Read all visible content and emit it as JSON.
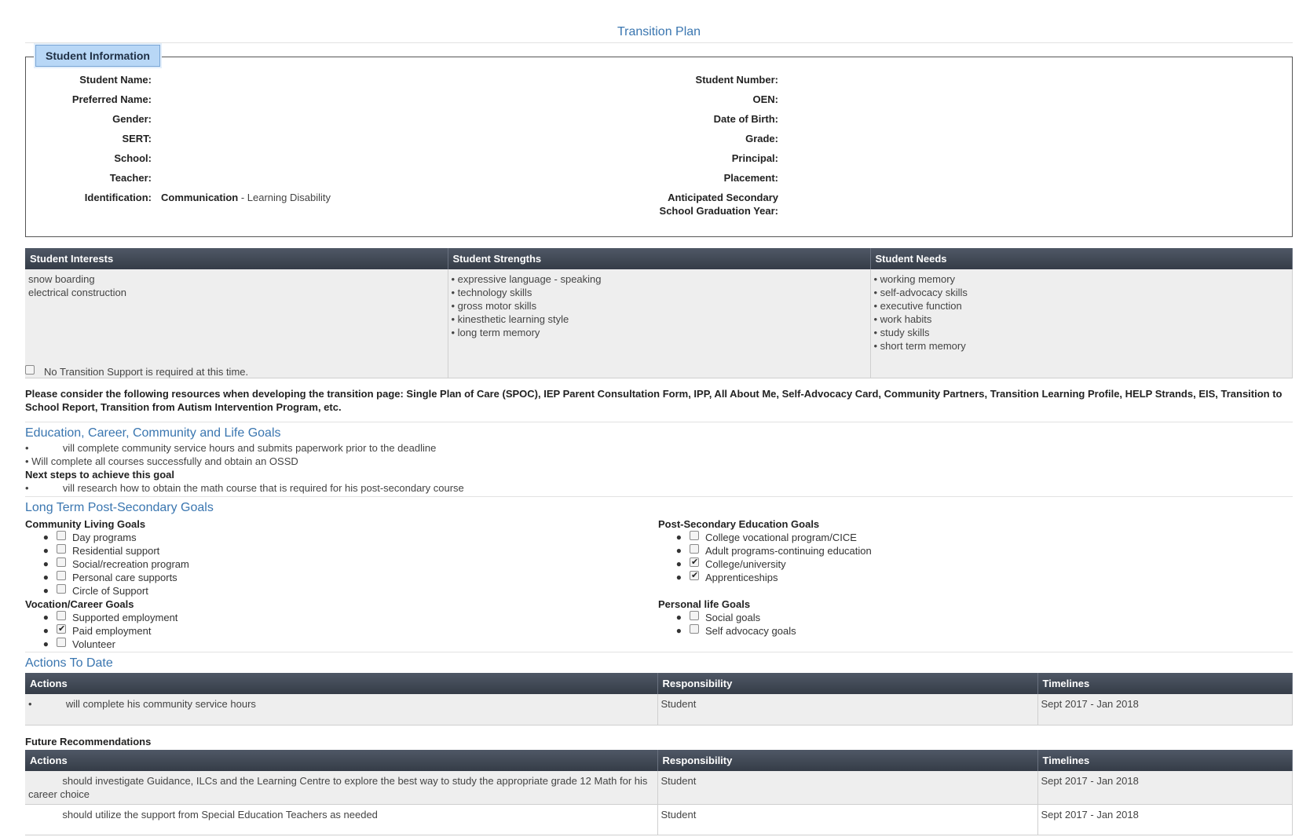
{
  "title": "Transition Plan",
  "student_info": {
    "legend": "Student Information",
    "left": [
      {
        "label": "Student Name:",
        "value": ""
      },
      {
        "label": "Preferred Name:",
        "value": ""
      },
      {
        "label": "Gender:",
        "value": ""
      },
      {
        "label": "SERT:",
        "value": ""
      },
      {
        "label": "School:",
        "value": ""
      },
      {
        "label": "Teacher:",
        "value": ""
      },
      {
        "label": "Identification:",
        "value_bold": "Communication",
        "value": " - Learning Disability"
      }
    ],
    "right": [
      {
        "label": "Student Number:",
        "value": ""
      },
      {
        "label": "OEN:",
        "value": ""
      },
      {
        "label": "Date of Birth:",
        "value": ""
      },
      {
        "label": "Grade:",
        "value": ""
      },
      {
        "label": "Principal:",
        "value": ""
      },
      {
        "label": "Placement:",
        "value": ""
      },
      {
        "label": "Anticipated Secondary School Graduation Year:",
        "value": ""
      }
    ]
  },
  "profile": {
    "headers": [
      "Student Interests",
      "Student Strengths",
      "Student Needs"
    ],
    "interests": [
      "snow boarding",
      "electrical construction"
    ],
    "strengths": [
      "• expressive language - speaking",
      "• technology skills",
      "• gross motor skills",
      "• kinesthetic learning style",
      "• long term memory"
    ],
    "needs": [
      "• working memory",
      "• self-advocacy skills",
      "• executive function",
      "• work habits",
      "• study skills",
      "• short term memory"
    ]
  },
  "no_support": {
    "label": "No Transition Support is required at this time.",
    "checked": false
  },
  "resources_note": "Please consider the following resources when developing the transition page: Single Plan of Care (SPOC), IEP Parent Consultation Form, IPP, All About Me, Self-Advocacy Card, Community Partners, Transition Learning Profile, HELP Strands, EIS, Transition to School Report, Transition from Autism Intervention Program, etc.",
  "edu_goals": {
    "title": "Education, Career, Community and Life Goals",
    "items": [
      "•            vill complete community service hours and submits paperwork prior to the deadline",
      "• Will complete all courses successfully and obtain an OSSD"
    ],
    "next_steps_label": "Next steps to achieve this goal",
    "next_steps": [
      "•            vill research how to obtain the math course that is required for his post-secondary course"
    ]
  },
  "long_term": {
    "title": "Long Term Post-Secondary Goals",
    "community": {
      "label": "Community Living Goals",
      "items": [
        {
          "text": "Day programs",
          "checked": false
        },
        {
          "text": "Residential support",
          "checked": false
        },
        {
          "text": "Social/recreation program",
          "checked": false
        },
        {
          "text": "Personal care supports",
          "checked": false
        },
        {
          "text": "Circle of Support",
          "checked": false
        }
      ]
    },
    "vocation": {
      "label": "Vocation/Career Goals",
      "items": [
        {
          "text": "Supported employment",
          "checked": false
        },
        {
          "text": "Paid employment",
          "checked": true
        },
        {
          "text": "Volunteer",
          "checked": false
        }
      ]
    },
    "post_secondary": {
      "label": "Post-Secondary Education Goals",
      "items": [
        {
          "text": "College vocational program/CICE",
          "checked": false
        },
        {
          "text": "Adult programs-continuing education",
          "checked": false
        },
        {
          "text": "College/university",
          "checked": true
        },
        {
          "text": "Apprenticeships",
          "checked": true
        }
      ]
    },
    "personal": {
      "label": "Personal life Goals",
      "items": [
        {
          "text": "Social goals",
          "checked": false
        },
        {
          "text": "Self advocacy goals",
          "checked": false
        }
      ]
    }
  },
  "actions_to_date": {
    "title": "Actions To Date",
    "headers": [
      "Actions",
      "Responsibility",
      "Timelines"
    ],
    "rows": [
      {
        "action": "•            will complete his community service hours",
        "resp": "Student",
        "time": "Sept 2017 - Jan 2018"
      }
    ]
  },
  "future": {
    "title": "Future Recommendations",
    "headers": [
      "Actions",
      "Responsibility",
      "Timelines"
    ],
    "rows": [
      {
        "action": "            should investigate Guidance, ILCs and the Learning Centre to explore the best way to study the appropriate grade 12 Math for his career choice",
        "resp": "Student",
        "time": "Sept 2017 - Jan 2018"
      },
      {
        "action": "            should utilize the support from Special Education Teachers as needed",
        "resp": "Student",
        "time": "Sept 2017 - Jan 2018"
      }
    ]
  }
}
